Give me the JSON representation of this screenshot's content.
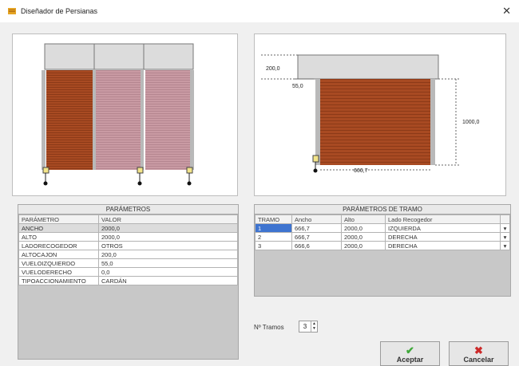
{
  "window": {
    "title": "Diseñador de Persianas",
    "close_glyph": "✕"
  },
  "params": {
    "title": "PARÁMETROS",
    "headers": [
      "PARÁMETRO",
      "VALOR"
    ],
    "rows": [
      [
        "ANCHO",
        "2000,0"
      ],
      [
        "ALTO",
        "2000,0"
      ],
      [
        "LADORECOGEDOR",
        "OTROS"
      ],
      [
        "ALTOCAJON",
        "200,0"
      ],
      [
        "VUELOIZQUIERDO",
        "55,0"
      ],
      [
        "VUELODERECHO",
        "0,0"
      ],
      [
        "TIPOACCIONAMIENTO",
        "CARDÁN"
      ]
    ]
  },
  "tramos": {
    "title": "PARÁMETROS DE TRAMO",
    "headers": [
      "TRAMO",
      "Ancho",
      "Alto",
      "Lado Recogedor"
    ],
    "rows": [
      [
        "1",
        "666,7",
        "2000,0",
        "IZQUIERDA"
      ],
      [
        "2",
        "666,7",
        "2000,0",
        "DERECHA"
      ],
      [
        "3",
        "666,6",
        "2000,0",
        "DERECHA"
      ]
    ]
  },
  "ntramos": {
    "label": "Nº Tramos",
    "value": "3"
  },
  "diagram": {
    "dim_top": "200,0",
    "dim_left": "55,0",
    "dim_right": "1000,0",
    "dim_bottom": "666,7"
  },
  "buttons": {
    "accept": "Aceptar",
    "cancel": "Cancelar"
  },
  "colors": {
    "shutter": "#a84a22",
    "shutter_pink": "#c99aa3",
    "accept": "#3fa83a",
    "cancel": "#cc2a2a"
  }
}
